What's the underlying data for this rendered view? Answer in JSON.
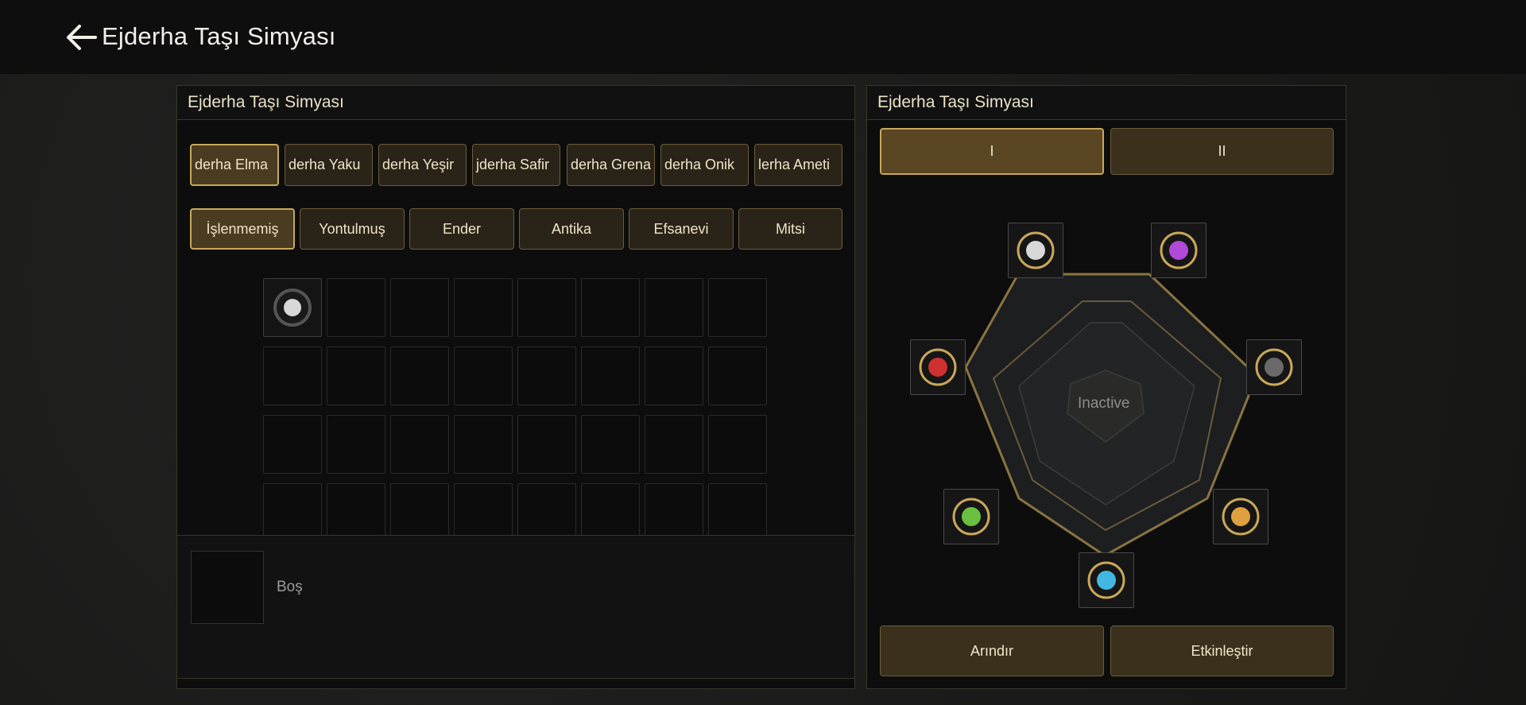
{
  "header": {
    "title": "Ejderha Taşı Simyası"
  },
  "left_panel": {
    "title": "Ejderha Taşı Simyası",
    "stone_tabs": [
      "Ejderha Elmas",
      "Ejderha Yakut",
      "Ejderha Yeşim",
      "Ejderha Safir",
      "Ejderha Grena",
      "Ejderha Oniks",
      "Ejderha Ametist"
    ],
    "stone_tabs_visible": [
      "derha Elma",
      "derha Yaku",
      "derha Yeşir",
      "jderha Safir",
      "derha Grena",
      "derha Onik",
      "lerha Ameti"
    ],
    "selected_stone_tab": 0,
    "grade_tabs": [
      "İşlenmemiş",
      "Yontulmuş",
      "Ender",
      "Antika",
      "Efsanevi",
      "Mitsi"
    ],
    "selected_grade_tab": 0,
    "inventory": {
      "filled_slots": 1,
      "slot_icon": "white-dragon-stone-icon"
    },
    "detail": {
      "label": "Boş"
    }
  },
  "right_panel": {
    "title": "Ejderha Taşı Simyası",
    "page_tabs": [
      "I",
      "II"
    ],
    "selected_page_tab": 0,
    "center_label": "Inactive",
    "sockets": [
      {
        "name": "white-stone-socket",
        "color": "#d8d8d8"
      },
      {
        "name": "purple-stone-socket",
        "color": "#b14ad8"
      },
      {
        "name": "black-stone-socket",
        "color": "#6a6a6a"
      },
      {
        "name": "orange-stone-socket",
        "color": "#e0a040"
      },
      {
        "name": "blue-stone-socket",
        "color": "#42b8e0"
      },
      {
        "name": "green-stone-socket",
        "color": "#6ac040"
      },
      {
        "name": "red-stone-socket",
        "color": "#d03030"
      }
    ],
    "buttons": {
      "purify": "Arındır",
      "activate": "Etkinleştir"
    }
  },
  "colors": {
    "accent": "#c8a85a",
    "frame": "#8a7440"
  }
}
